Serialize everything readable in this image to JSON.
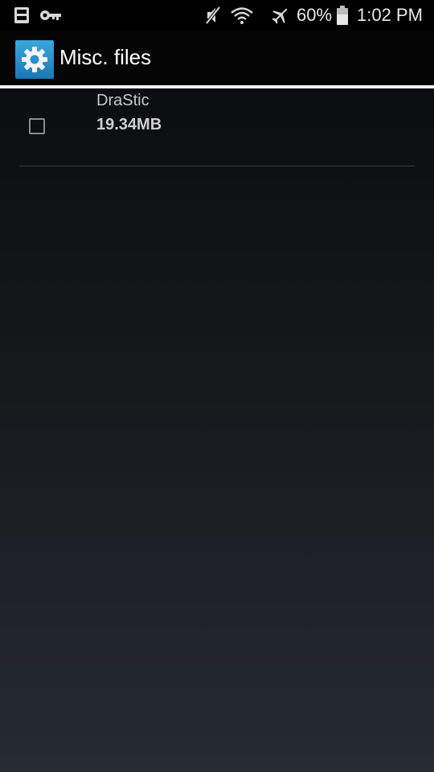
{
  "status_bar": {
    "icons": [
      "sd-card-icon",
      "vpn-key-icon",
      "mute-icon",
      "wifi-icon",
      "airplane-icon",
      "battery-icon"
    ],
    "battery": "60%",
    "time": "1:02 PM"
  },
  "action_bar": {
    "icon": "gear-icon",
    "title": "Misc. files",
    "icon_color": "#2a8fcc"
  },
  "files": [
    {
      "name": "DraStic",
      "size": "19.34MB",
      "checked": false
    }
  ]
}
